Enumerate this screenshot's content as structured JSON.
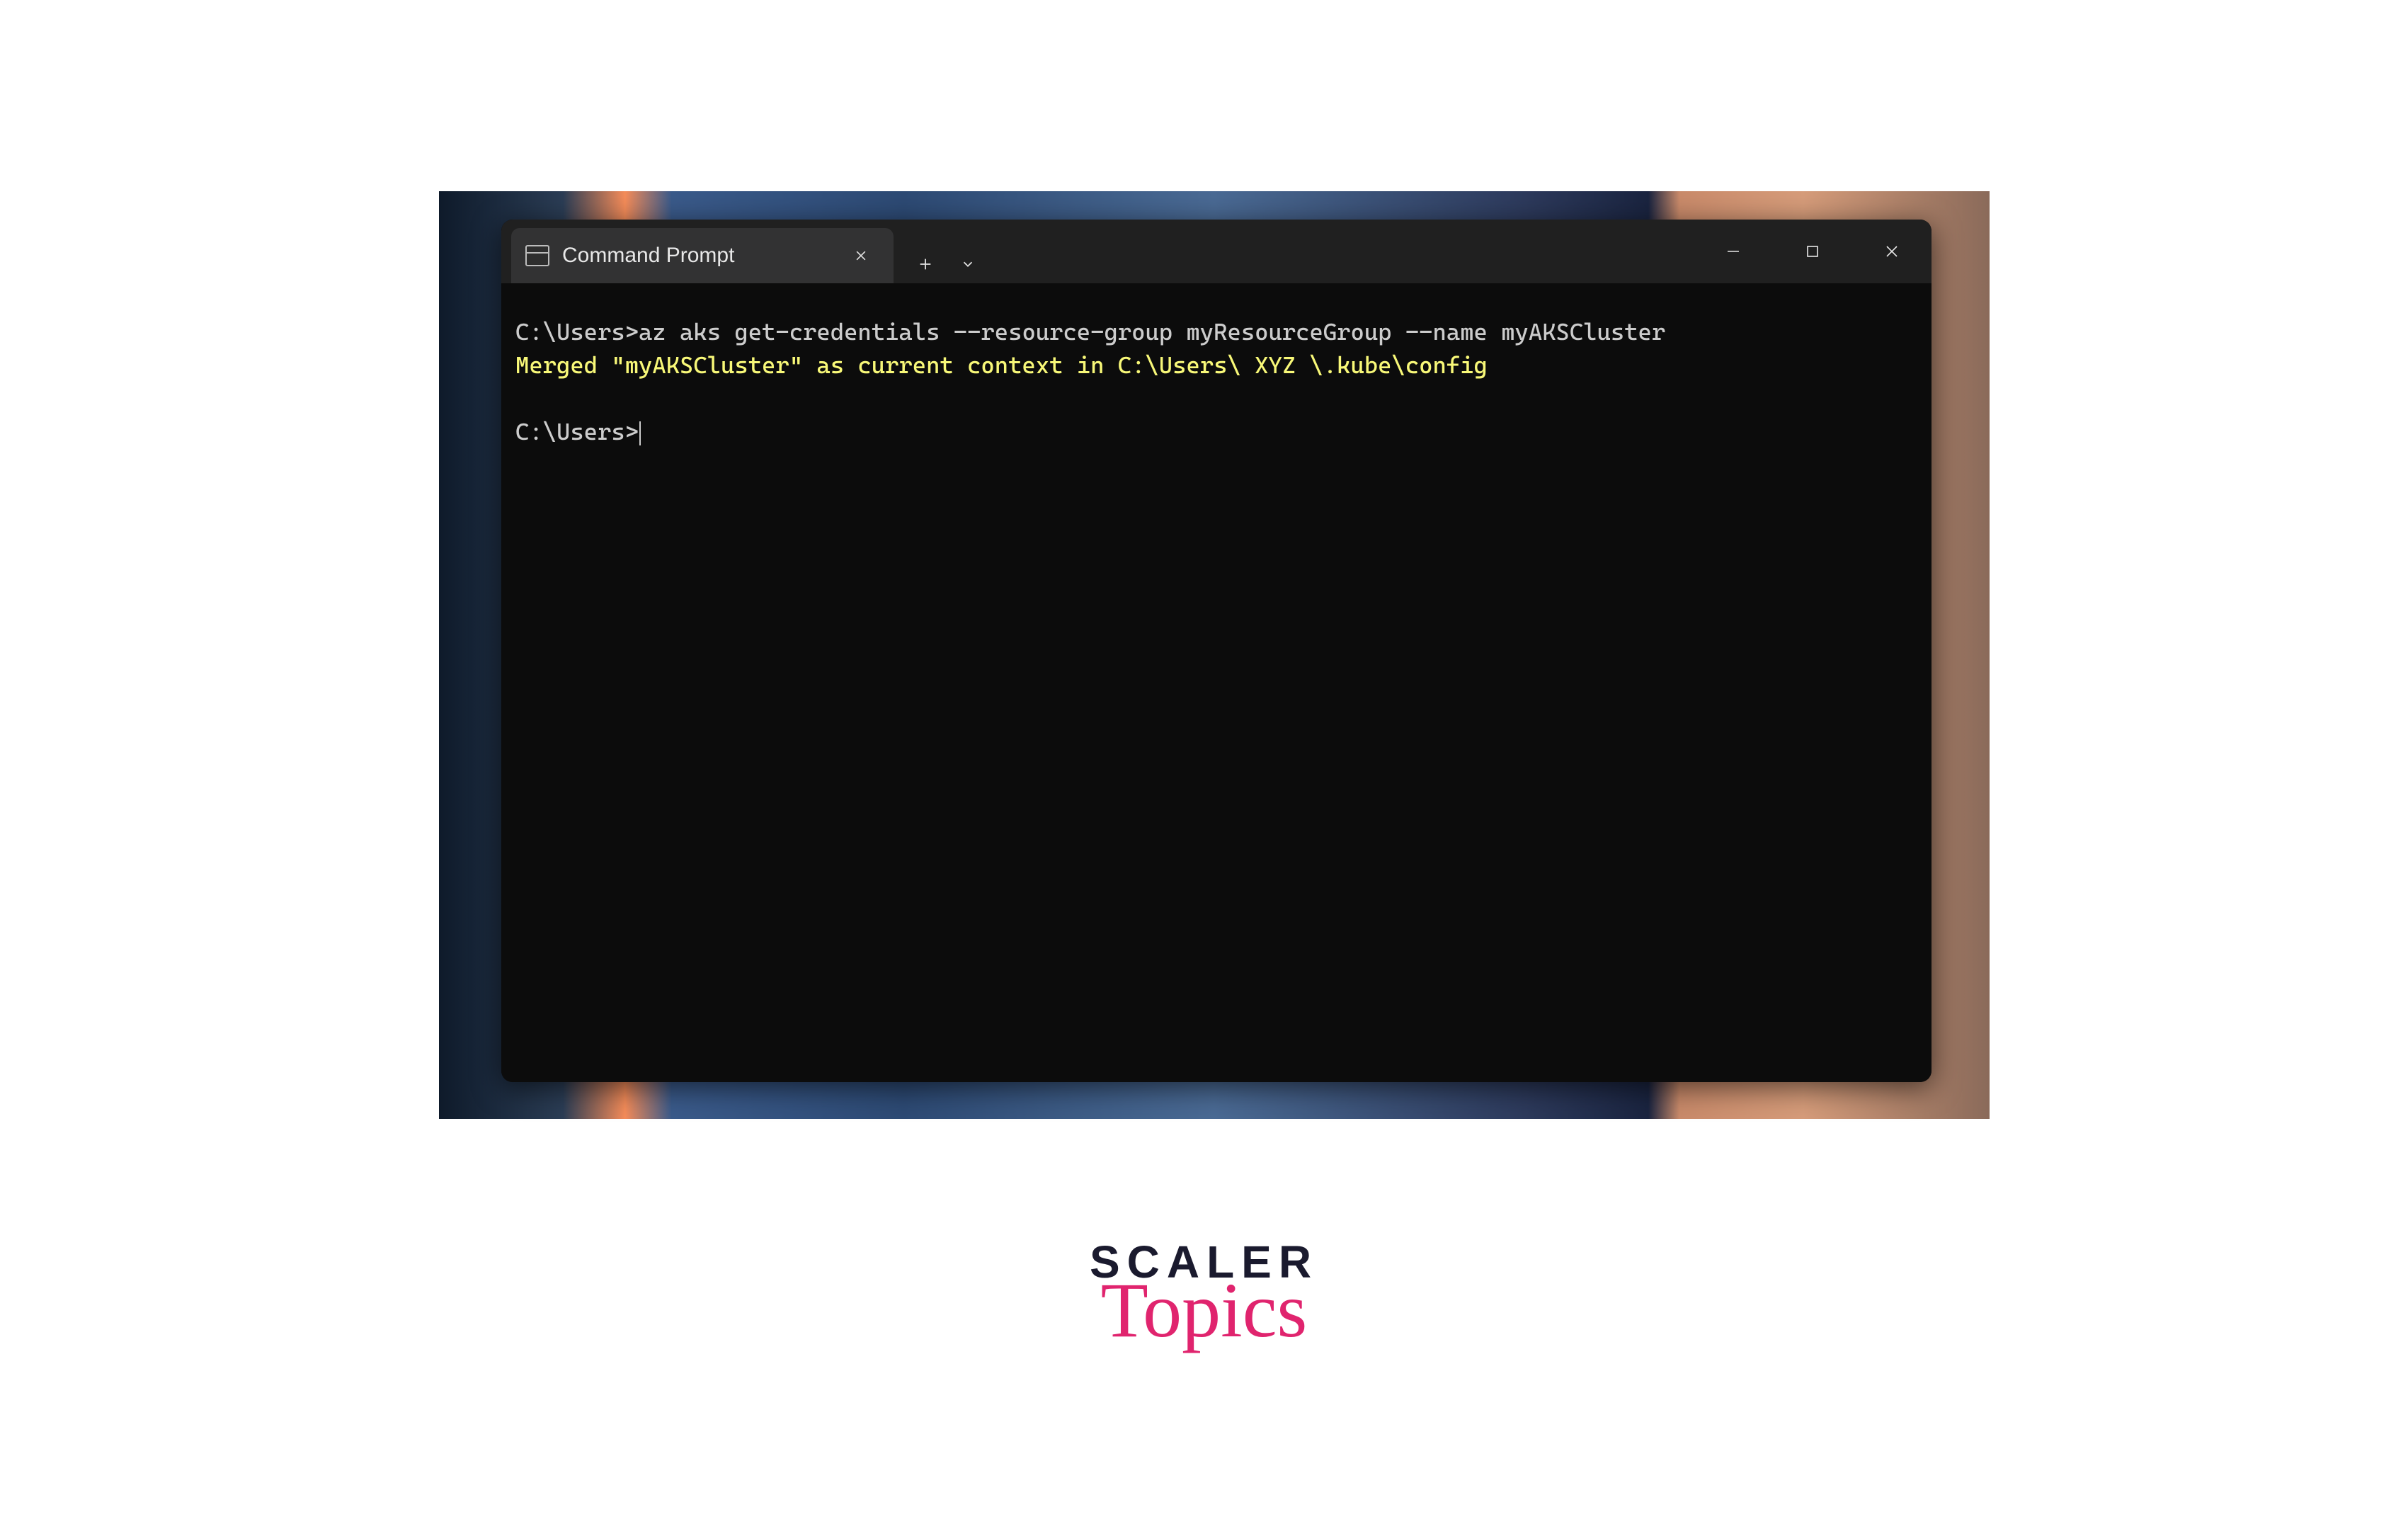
{
  "tab": {
    "title": "Command Prompt"
  },
  "terminal": {
    "prompt1": "C:\\Users>",
    "command1": "az aks get-credentials --resource-group myResourceGroup --name myAKSCluster",
    "output1": "Merged \"myAKSCluster\" as current context in C:\\Users\\ XYZ \\.kube\\config",
    "prompt2": "C:\\Users>"
  },
  "branding": {
    "line1": "SCALER",
    "line2": "Topics"
  }
}
